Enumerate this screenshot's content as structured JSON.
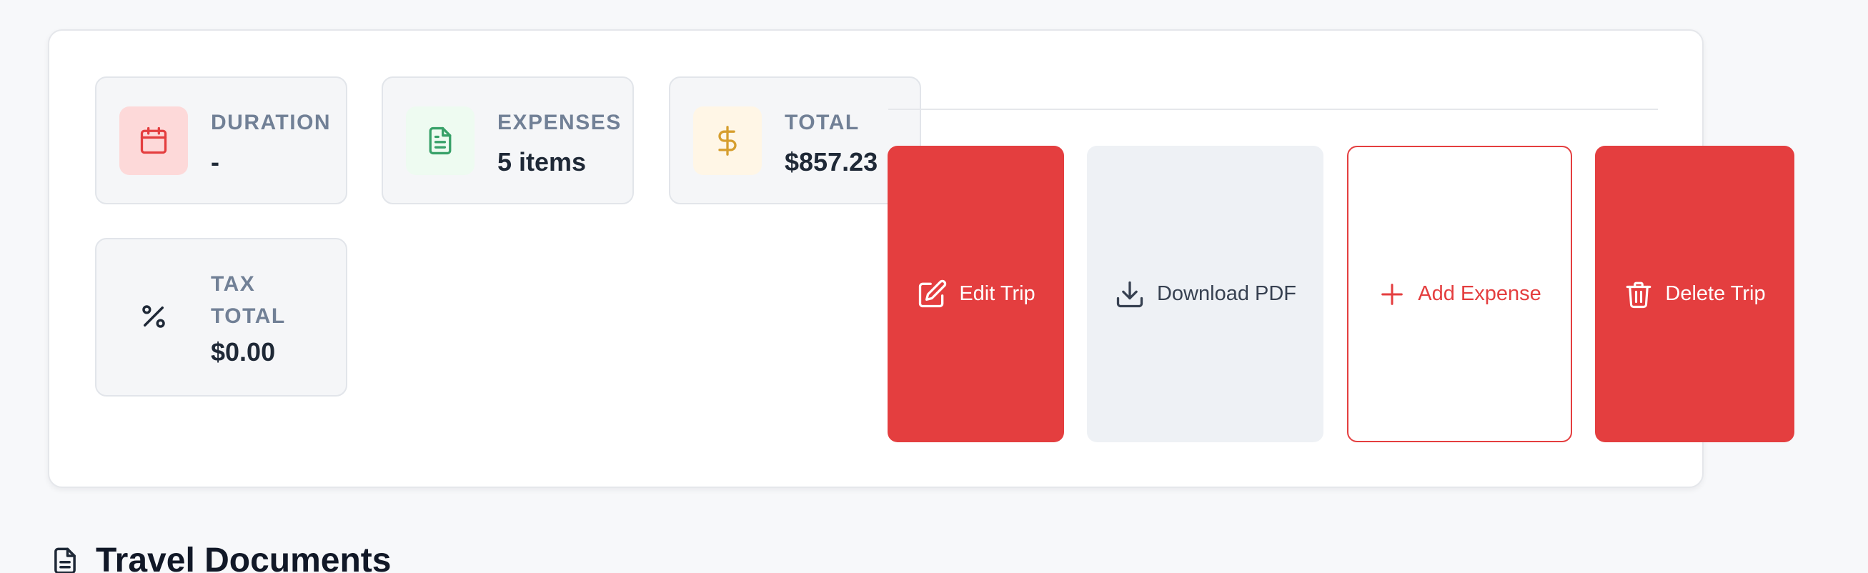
{
  "stats": {
    "duration": {
      "label": "DURATION",
      "value": "-",
      "icon": "calendar-icon",
      "icon_color": "#e43e3f",
      "icon_bg": "#fdd9d9"
    },
    "expenses": {
      "label": "EXPENSES",
      "value": "5 items",
      "icon": "document-icon",
      "icon_color": "#38a169",
      "icon_bg": "#eefbf1"
    },
    "total": {
      "label": "TOTAL",
      "value": "$857.23",
      "icon": "dollar-icon",
      "icon_color": "#d69e2e",
      "icon_bg": "#fff6e6"
    },
    "tax_total": {
      "label_line1": "TAX",
      "label_line2": "TOTAL",
      "value": "$0.00",
      "icon": "percent-icon",
      "icon_color": "#1f2937"
    }
  },
  "actions": {
    "edit_trip": "Edit Trip",
    "download_pdf": "Download PDF",
    "add_expense": "Add Expense",
    "delete_trip": "Delete Trip"
  },
  "colors": {
    "accent_red": "#e43e3f",
    "secondary_button_bg": "#eef1f5"
  },
  "section": {
    "title": "Travel Documents",
    "icon": "document-icon"
  }
}
